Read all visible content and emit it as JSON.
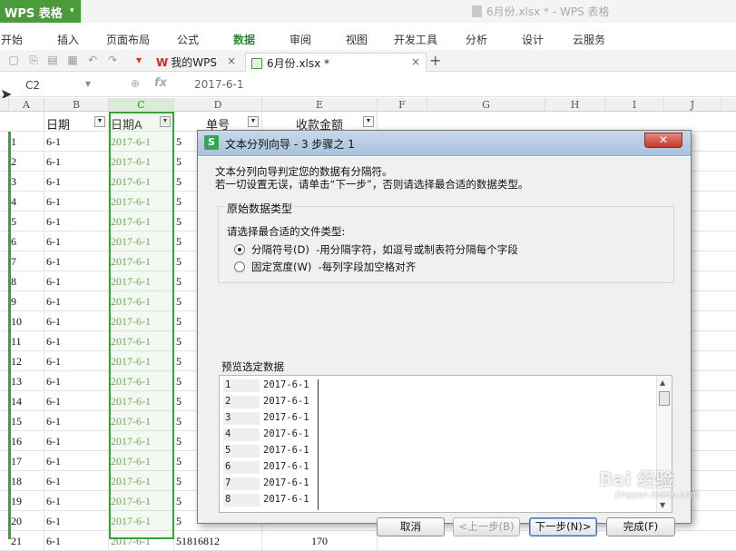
{
  "app": {
    "name": "WPS 表格",
    "dropdown": "▾"
  },
  "window": {
    "title": "6月份.xlsx * - WPS 表格"
  },
  "menu": [
    "开始",
    "插入",
    "页面布局",
    "公式",
    "数据",
    "审阅",
    "视图",
    "开发工具",
    "分析",
    "设计",
    "云服务"
  ],
  "active_menu": "数据",
  "tabs": {
    "wps": {
      "label": "我的WPS",
      "close": "×"
    },
    "file": {
      "label": "6月份.xlsx *",
      "close": "×"
    },
    "new": "+"
  },
  "formula_bar": {
    "name_box": "C2",
    "fx": "fx",
    "zoom_glyph": "⊕",
    "formula": "2017-6-1"
  },
  "columns": [
    "A",
    "B",
    "C",
    "D",
    "E",
    "F",
    "G",
    "H",
    "I",
    "J"
  ],
  "sheet": {
    "headers": [
      "日期",
      "日期A",
      "单号",
      "收款金额"
    ],
    "rows": [
      {
        "a": "1",
        "b": "6-1",
        "c": "2017-6-1",
        "d": "5"
      },
      {
        "a": "2",
        "b": "6-1",
        "c": "2017-6-1",
        "d": "5"
      },
      {
        "a": "3",
        "b": "6-1",
        "c": "2017-6-1",
        "d": "5"
      },
      {
        "a": "4",
        "b": "6-1",
        "c": "2017-6-1",
        "d": "5"
      },
      {
        "a": "5",
        "b": "6-1",
        "c": "2017-6-1",
        "d": "5"
      },
      {
        "a": "6",
        "b": "6-1",
        "c": "2017-6-1",
        "d": "5"
      },
      {
        "a": "7",
        "b": "6-1",
        "c": "2017-6-1",
        "d": "5"
      },
      {
        "a": "8",
        "b": "6-1",
        "c": "2017-6-1",
        "d": "5"
      },
      {
        "a": "9",
        "b": "6-1",
        "c": "2017-6-1",
        "d": "5"
      },
      {
        "a": "10",
        "b": "6-1",
        "c": "2017-6-1",
        "d": "5"
      },
      {
        "a": "11",
        "b": "6-1",
        "c": "2017-6-1",
        "d": "5"
      },
      {
        "a": "12",
        "b": "6-1",
        "c": "2017-6-1",
        "d": "5"
      },
      {
        "a": "13",
        "b": "6-1",
        "c": "2017-6-1",
        "d": "5"
      },
      {
        "a": "14",
        "b": "6-1",
        "c": "2017-6-1",
        "d": "5"
      },
      {
        "a": "15",
        "b": "6-1",
        "c": "2017-6-1",
        "d": "5"
      },
      {
        "a": "16",
        "b": "6-1",
        "c": "2017-6-1",
        "d": "5"
      },
      {
        "a": "17",
        "b": "6-1",
        "c": "2017-6-1",
        "d": "5"
      },
      {
        "a": "18",
        "b": "6-1",
        "c": "2017-6-1",
        "d": "5"
      },
      {
        "a": "19",
        "b": "6-1",
        "c": "2017-6-1",
        "d": "5"
      },
      {
        "a": "20",
        "b": "6-1",
        "c": "2017-6-1",
        "d": "5"
      },
      {
        "a": "21",
        "b": "6-1",
        "c": "2017-6-1",
        "d": "51816812",
        "e": "170"
      }
    ]
  },
  "dialog": {
    "logo": "S",
    "title": "文本分列向导 - 3 步骤之 1",
    "close": "✕",
    "intro_line1": "文本分列向导判定您的数据有分隔符。",
    "intro_line2": "若一切设置无误，请单击“下一步”，否则请选择最合适的数据类型。",
    "group_label": "原始数据类型",
    "prompt": "请选择最合适的文件类型:",
    "options": [
      {
        "label": "分隔符号(D)",
        "desc": "-用分隔字符，如逗号或制表符分隔每个字段",
        "selected": true
      },
      {
        "label": "固定宽度(W)",
        "desc": "-每列字段加空格对齐",
        "selected": false
      }
    ],
    "preview_label": "预览选定数据",
    "preview": [
      {
        "n": "1",
        "v": "2017-6-1"
      },
      {
        "n": "2",
        "v": "2017-6-1"
      },
      {
        "n": "3",
        "v": "2017-6-1"
      },
      {
        "n": "4",
        "v": "2017-6-1"
      },
      {
        "n": "5",
        "v": "2017-6-1"
      },
      {
        "n": "6",
        "v": "2017-6-1"
      },
      {
        "n": "7",
        "v": "2017-6-1"
      },
      {
        "n": "8",
        "v": "2017-6-1"
      }
    ],
    "buttons": {
      "cancel": "取消",
      "back": "<上一步(B)",
      "next": "下一步(N)>",
      "finish": "完成(F)"
    }
  },
  "watermark": {
    "line1": "Bai 经验",
    "line2": "jingyan.baidu.com"
  },
  "colors": {
    "accent": "#4a9b3c",
    "selection": "#3aa23a"
  }
}
